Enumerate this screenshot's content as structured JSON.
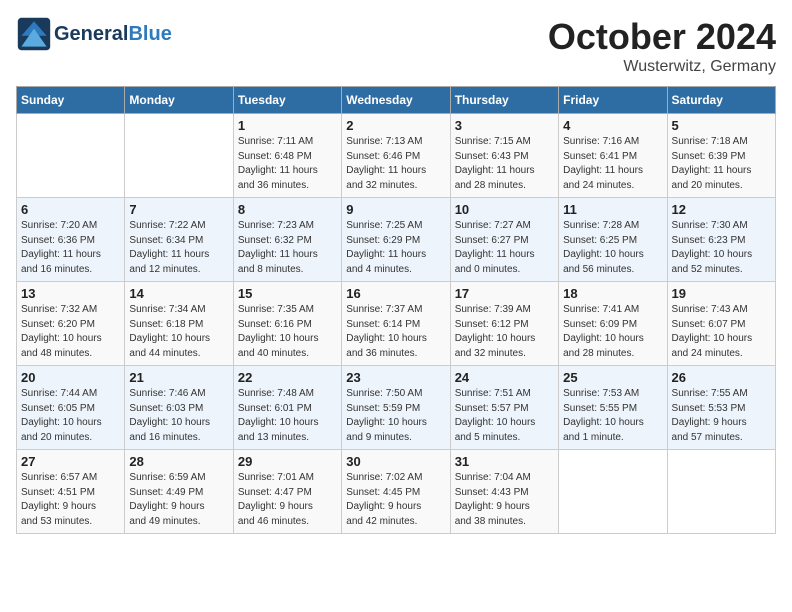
{
  "header": {
    "logo_general": "General",
    "logo_blue": "Blue",
    "month_year": "October 2024",
    "location": "Wusterwitz, Germany"
  },
  "days_of_week": [
    "Sunday",
    "Monday",
    "Tuesday",
    "Wednesday",
    "Thursday",
    "Friday",
    "Saturday"
  ],
  "weeks": [
    [
      {
        "day": "",
        "info": ""
      },
      {
        "day": "",
        "info": ""
      },
      {
        "day": "1",
        "info": "Sunrise: 7:11 AM\nSunset: 6:48 PM\nDaylight: 11 hours\nand 36 minutes."
      },
      {
        "day": "2",
        "info": "Sunrise: 7:13 AM\nSunset: 6:46 PM\nDaylight: 11 hours\nand 32 minutes."
      },
      {
        "day": "3",
        "info": "Sunrise: 7:15 AM\nSunset: 6:43 PM\nDaylight: 11 hours\nand 28 minutes."
      },
      {
        "day": "4",
        "info": "Sunrise: 7:16 AM\nSunset: 6:41 PM\nDaylight: 11 hours\nand 24 minutes."
      },
      {
        "day": "5",
        "info": "Sunrise: 7:18 AM\nSunset: 6:39 PM\nDaylight: 11 hours\nand 20 minutes."
      }
    ],
    [
      {
        "day": "6",
        "info": "Sunrise: 7:20 AM\nSunset: 6:36 PM\nDaylight: 11 hours\nand 16 minutes."
      },
      {
        "day": "7",
        "info": "Sunrise: 7:22 AM\nSunset: 6:34 PM\nDaylight: 11 hours\nand 12 minutes."
      },
      {
        "day": "8",
        "info": "Sunrise: 7:23 AM\nSunset: 6:32 PM\nDaylight: 11 hours\nand 8 minutes."
      },
      {
        "day": "9",
        "info": "Sunrise: 7:25 AM\nSunset: 6:29 PM\nDaylight: 11 hours\nand 4 minutes."
      },
      {
        "day": "10",
        "info": "Sunrise: 7:27 AM\nSunset: 6:27 PM\nDaylight: 11 hours\nand 0 minutes."
      },
      {
        "day": "11",
        "info": "Sunrise: 7:28 AM\nSunset: 6:25 PM\nDaylight: 10 hours\nand 56 minutes."
      },
      {
        "day": "12",
        "info": "Sunrise: 7:30 AM\nSunset: 6:23 PM\nDaylight: 10 hours\nand 52 minutes."
      }
    ],
    [
      {
        "day": "13",
        "info": "Sunrise: 7:32 AM\nSunset: 6:20 PM\nDaylight: 10 hours\nand 48 minutes."
      },
      {
        "day": "14",
        "info": "Sunrise: 7:34 AM\nSunset: 6:18 PM\nDaylight: 10 hours\nand 44 minutes."
      },
      {
        "day": "15",
        "info": "Sunrise: 7:35 AM\nSunset: 6:16 PM\nDaylight: 10 hours\nand 40 minutes."
      },
      {
        "day": "16",
        "info": "Sunrise: 7:37 AM\nSunset: 6:14 PM\nDaylight: 10 hours\nand 36 minutes."
      },
      {
        "day": "17",
        "info": "Sunrise: 7:39 AM\nSunset: 6:12 PM\nDaylight: 10 hours\nand 32 minutes."
      },
      {
        "day": "18",
        "info": "Sunrise: 7:41 AM\nSunset: 6:09 PM\nDaylight: 10 hours\nand 28 minutes."
      },
      {
        "day": "19",
        "info": "Sunrise: 7:43 AM\nSunset: 6:07 PM\nDaylight: 10 hours\nand 24 minutes."
      }
    ],
    [
      {
        "day": "20",
        "info": "Sunrise: 7:44 AM\nSunset: 6:05 PM\nDaylight: 10 hours\nand 20 minutes."
      },
      {
        "day": "21",
        "info": "Sunrise: 7:46 AM\nSunset: 6:03 PM\nDaylight: 10 hours\nand 16 minutes."
      },
      {
        "day": "22",
        "info": "Sunrise: 7:48 AM\nSunset: 6:01 PM\nDaylight: 10 hours\nand 13 minutes."
      },
      {
        "day": "23",
        "info": "Sunrise: 7:50 AM\nSunset: 5:59 PM\nDaylight: 10 hours\nand 9 minutes."
      },
      {
        "day": "24",
        "info": "Sunrise: 7:51 AM\nSunset: 5:57 PM\nDaylight: 10 hours\nand 5 minutes."
      },
      {
        "day": "25",
        "info": "Sunrise: 7:53 AM\nSunset: 5:55 PM\nDaylight: 10 hours\nand 1 minute."
      },
      {
        "day": "26",
        "info": "Sunrise: 7:55 AM\nSunset: 5:53 PM\nDaylight: 9 hours\nand 57 minutes."
      }
    ],
    [
      {
        "day": "27",
        "info": "Sunrise: 6:57 AM\nSunset: 4:51 PM\nDaylight: 9 hours\nand 53 minutes."
      },
      {
        "day": "28",
        "info": "Sunrise: 6:59 AM\nSunset: 4:49 PM\nDaylight: 9 hours\nand 49 minutes."
      },
      {
        "day": "29",
        "info": "Sunrise: 7:01 AM\nSunset: 4:47 PM\nDaylight: 9 hours\nand 46 minutes."
      },
      {
        "day": "30",
        "info": "Sunrise: 7:02 AM\nSunset: 4:45 PM\nDaylight: 9 hours\nand 42 minutes."
      },
      {
        "day": "31",
        "info": "Sunrise: 7:04 AM\nSunset: 4:43 PM\nDaylight: 9 hours\nand 38 minutes."
      },
      {
        "day": "",
        "info": ""
      },
      {
        "day": "",
        "info": ""
      }
    ]
  ]
}
